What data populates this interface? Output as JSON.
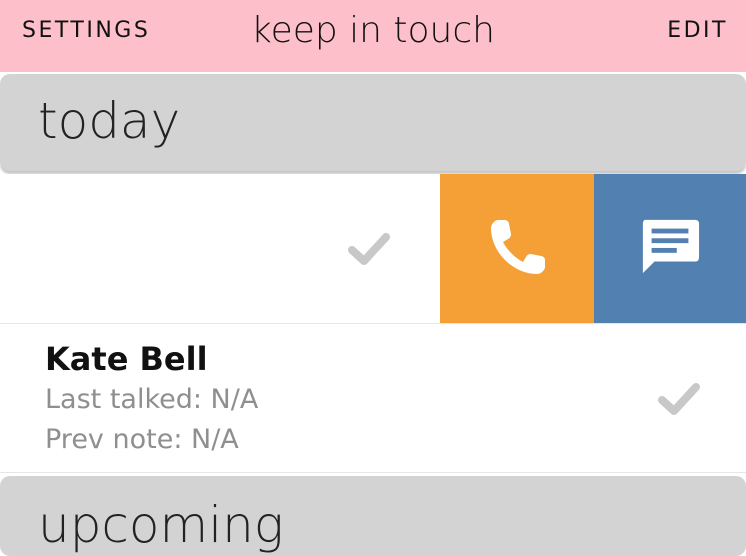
{
  "nav": {
    "left_label": "SETTINGS",
    "title": "keep in touch",
    "right_label": "EDIT",
    "background": "#fdc0cb"
  },
  "sections": {
    "today": "today",
    "upcoming": "upcoming"
  },
  "swiped_row": {
    "check_icon": "checkmark-icon",
    "actions": [
      {
        "name": "call",
        "icon": "phone-icon",
        "color": "#f5a037"
      },
      {
        "name": "message",
        "icon": "message-icon",
        "color": "#5280b1"
      }
    ]
  },
  "contact": {
    "name": "Kate Bell",
    "last_talked": "Last talked: N/A",
    "prev_note": "Prev note: N/A",
    "check_icon": "checkmark-icon"
  },
  "colors": {
    "section_bg": "#d3d3d3",
    "check_gray": "#c8c8c8",
    "subtext": "#8f8f8f"
  }
}
